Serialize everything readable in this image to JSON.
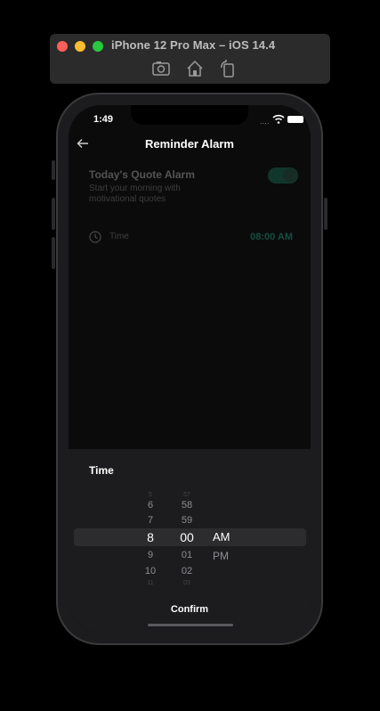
{
  "simulator": {
    "title": "iPhone 12 Pro Max – iOS 14.4",
    "tools": [
      "camera-icon",
      "home-icon",
      "rotate-icon"
    ]
  },
  "status_bar": {
    "time": "1:49",
    "signal": "...."
  },
  "nav": {
    "title": "Reminder Alarm"
  },
  "alarm": {
    "title": "Today's Quote Alarm",
    "subtitle": "Start your morning with motivational quotes",
    "enabled": true,
    "time_label": "Time",
    "time_value": "08:00 AM"
  },
  "picker": {
    "title": "Time",
    "hours": [
      "5",
      "6",
      "7",
      "8",
      "9",
      "10",
      "11"
    ],
    "minutes": [
      "57",
      "58",
      "59",
      "00",
      "01",
      "02",
      "03"
    ],
    "periods": [
      "AM",
      "PM"
    ],
    "selected": {
      "hour": "8",
      "minute": "00",
      "period": "AM"
    },
    "confirm_label": "Confirm"
  },
  "colors": {
    "accent": "#2ac79a",
    "toggle_on": "#1f8a6a",
    "sheet_bg": "#1c1c1e",
    "screen_bg": "#0b0b0c"
  }
}
